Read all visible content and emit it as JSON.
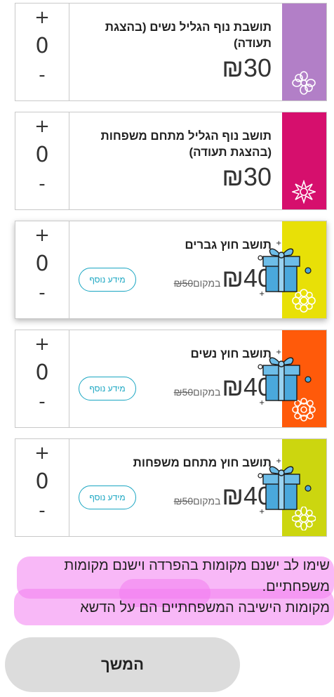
{
  "tickets": [
    {
      "title": "תושבת נוף הגליל נשים (בהצגת תעודה)",
      "price": "₪30",
      "quantity": "0",
      "plus": "+",
      "minus": "-",
      "color": "#b27fc7"
    },
    {
      "title": "תושב נוף הגליל מתחם משפחות (בהצגת תעודה)",
      "price": "₪30",
      "quantity": "0",
      "plus": "+",
      "minus": "-",
      "color": "#d60f6d"
    },
    {
      "title": "תושב חוץ גברים",
      "price": "₪40",
      "instead_label": "במקום",
      "old_price": "₪50",
      "info_label": "מידע נוסף",
      "quantity": "0",
      "plus": "+",
      "minus": "-",
      "color": "#e8e007"
    },
    {
      "title": "תושב חוץ נשים",
      "price": "₪40",
      "instead_label": "במקום",
      "old_price": "₪50",
      "info_label": "מידע נוסף",
      "quantity": "0",
      "plus": "+",
      "minus": "-",
      "color": "#ff5a0a"
    },
    {
      "title": "תושב חוץ מתחם משפחות",
      "price": "₪40",
      "instead_label": "במקום",
      "old_price": "₪50",
      "info_label": "מידע נוסף",
      "quantity": "0",
      "plus": "+",
      "minus": "-",
      "color": "#ccd60f"
    }
  ],
  "notice": {
    "line1": "שימו לב ישנם מקומות בהפרדה וישנם מקומות משפחתיים.",
    "line2": "מקומות הישיבה המשפחתיים הם על הדשא"
  },
  "continue_label": "המשך",
  "colors": {
    "info_button": "#1aa6c2",
    "highlight": "#f27ef0",
    "gift_blue": "#4aa8dc"
  },
  "icons": {
    "flower": "flower-icon",
    "gift": "gift-icon"
  }
}
